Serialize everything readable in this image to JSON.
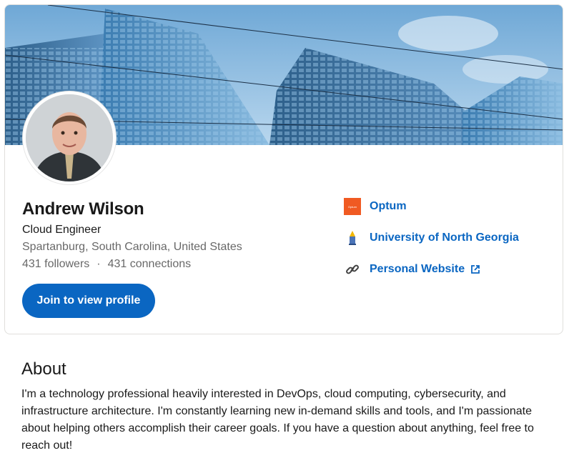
{
  "profile": {
    "name": "Andrew Wilson",
    "headline": "Cloud Engineer",
    "location": "Spartanburg, South Carolina, United States",
    "followers": "431 followers",
    "separator": "·",
    "connections": "431 connections",
    "join_button": "Join to view profile"
  },
  "links": {
    "company": {
      "label": "Optum",
      "logo_text": "Optum",
      "icon": "optum-logo"
    },
    "education": {
      "label": "University of North Georgia",
      "icon": "university-logo"
    },
    "website": {
      "label": "Personal Website",
      "icon": "link-icon",
      "external_icon": "external-link-icon"
    }
  },
  "about": {
    "title": "About",
    "text": "I'm a technology professional heavily interested in DevOps, cloud computing, cybersecurity, and infrastructure architecture. I'm constantly learning new in-demand skills and tools, and I'm passionate about helping others accomplish their career goals. If you have a question about anything, feel free to reach out!"
  },
  "colors": {
    "accent": "#0a66c2",
    "optum": "#f05a22"
  }
}
